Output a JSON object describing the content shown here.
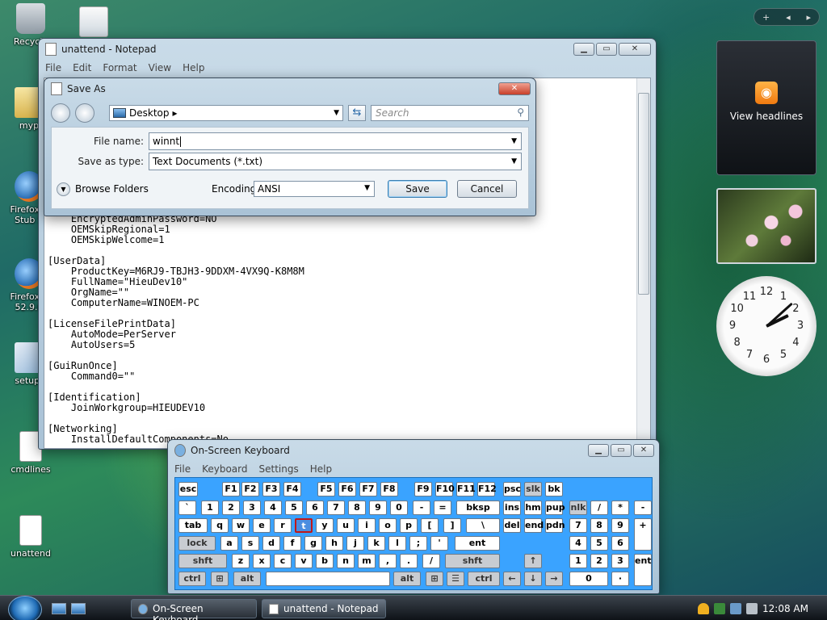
{
  "desktop": {
    "icons": [
      {
        "label": "Recycle",
        "type": "bin"
      },
      {
        "label": "myp",
        "type": "folder"
      },
      {
        "label": "Firefox S Stub S",
        "type": "firefox"
      },
      {
        "label": "Firefox S 52.9.0",
        "type": "firefox"
      },
      {
        "label": "setupr",
        "type": "setup"
      },
      {
        "label": "cmdlines",
        "type": "document"
      },
      {
        "label": "unattend",
        "type": "document"
      }
    ]
  },
  "notepad": {
    "title": "unattend - Notepad",
    "menu": [
      "File",
      "Edit",
      "Format",
      "View",
      "Help"
    ],
    "lines": [
      "    EncryptedAdminPassword=NO",
      "    OEMSkipRegional=1",
      "    OEMSkipWelcome=1",
      "",
      "[UserData]",
      "    ProductKey=M6RJ9-TBJH3-9DDXM-4VX9Q-K8M8M",
      "    FullName=\"HieuDev10\"",
      "    OrgName=\"\"",
      "    ComputerName=WINOEM-PC",
      "",
      "[LicenseFilePrintData]",
      "    AutoMode=PerServer",
      "    AutoUsers=5",
      "",
      "[GuiRunOnce]",
      "    Command0=\"\"",
      "",
      "[Identification]",
      "    JoinWorkgroup=HIEUDEV10",
      "",
      "[Networking]",
      "    InstallDefaultComponents=No"
    ]
  },
  "saveas": {
    "title": "Save As",
    "location": "Desktop",
    "search_placeholder": "Search",
    "file_name_label": "File name:",
    "file_name_value": "winnt",
    "save_type_label": "Save as type:",
    "save_type_value": "Text Documents (*.txt)",
    "browse_label": "Browse Folders",
    "encoding_label": "Encoding:",
    "encoding_value": "ANSI",
    "save_button": "Save",
    "cancel_button": "Cancel"
  },
  "gadgets": {
    "feed_label": "View headlines",
    "clock_numbers": [
      "12",
      "1",
      "2",
      "3",
      "4",
      "5",
      "6",
      "7",
      "8",
      "9",
      "10",
      "11"
    ]
  },
  "osk": {
    "title": "On-Screen Keyboard",
    "menu": [
      "File",
      "Keyboard",
      "Settings",
      "Help"
    ],
    "active_key": "t"
  },
  "taskbar": {
    "tasks": [
      "On-Screen Keyboard",
      "unattend - Notepad"
    ],
    "time": "12:08 AM"
  }
}
